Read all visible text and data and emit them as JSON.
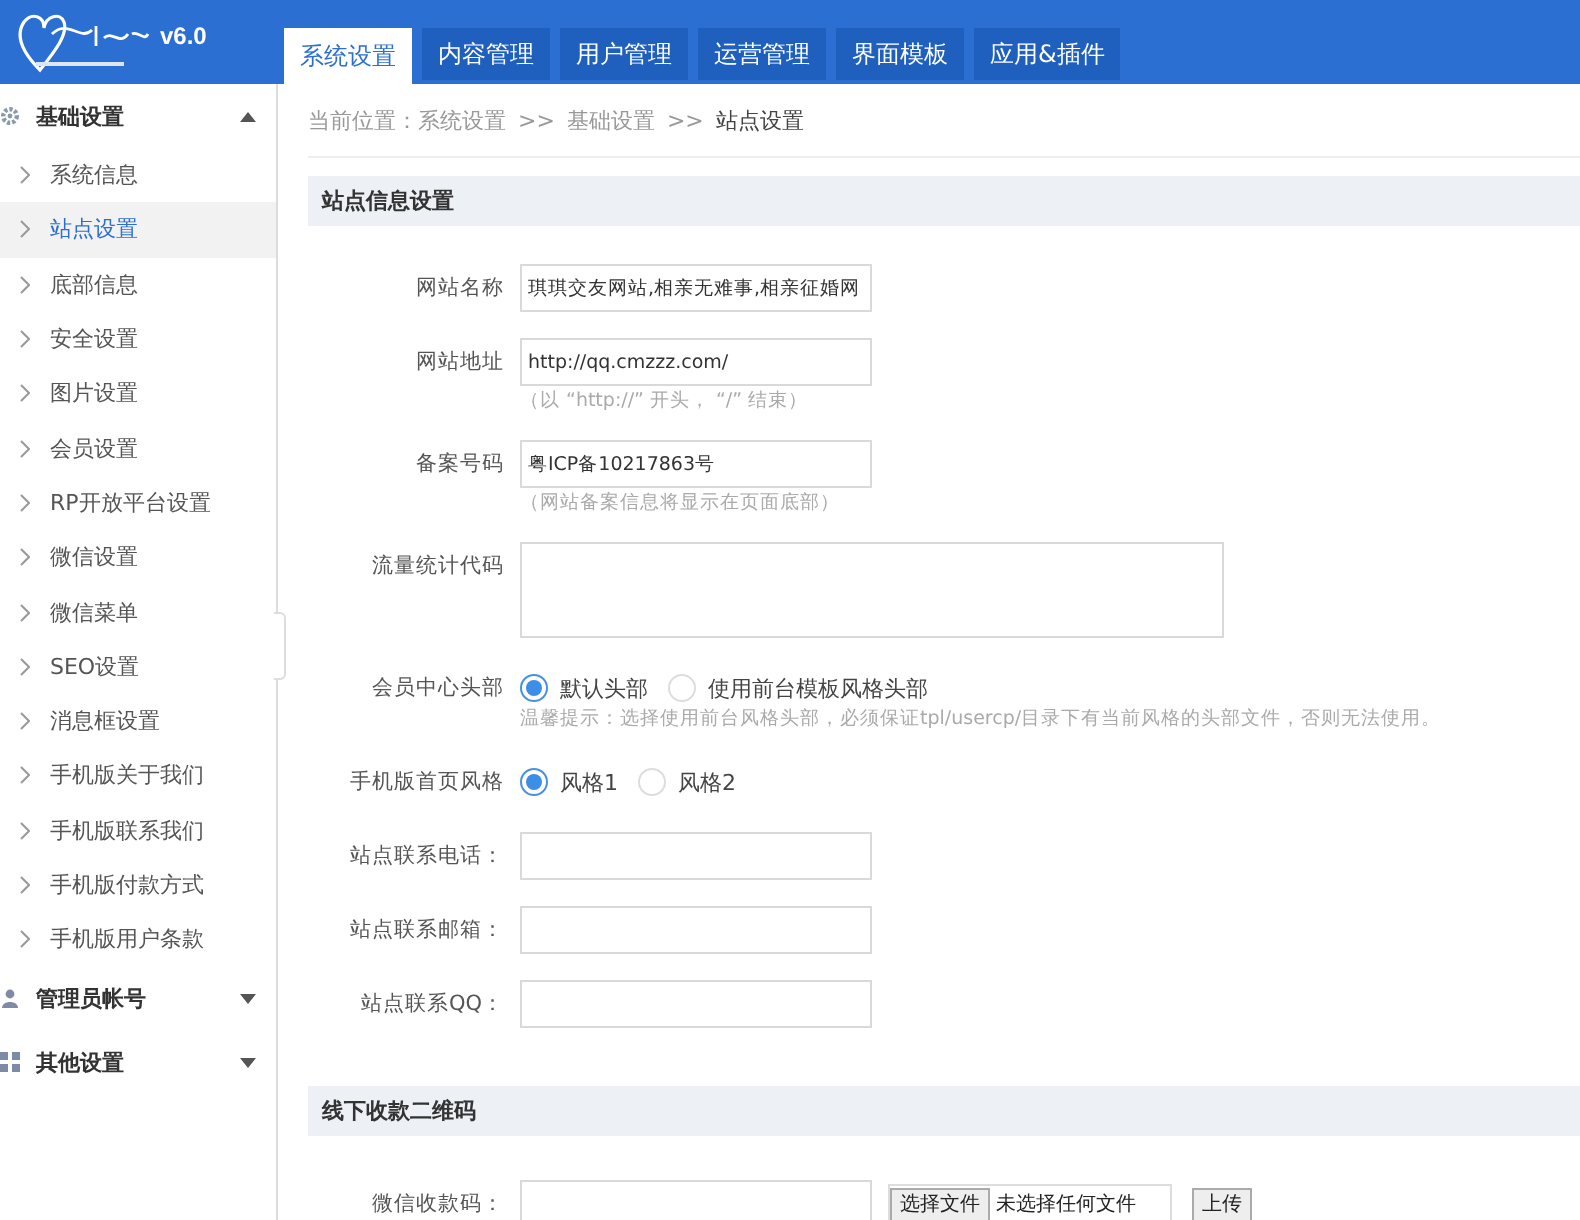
{
  "header": {
    "version": "v6.0",
    "tabs": [
      {
        "label": "系统设置",
        "selected": true
      },
      {
        "label": "内容管理",
        "selected": false
      },
      {
        "label": "用户管理",
        "selected": false
      },
      {
        "label": "运营管理",
        "selected": false
      },
      {
        "label": "界面模板",
        "selected": false
      },
      {
        "label": "应用&插件",
        "selected": false
      }
    ]
  },
  "sidebar": {
    "groups": [
      {
        "label": "基础设置",
        "expanded": true,
        "items": [
          {
            "label": "系统信息",
            "selected": false
          },
          {
            "label": "站点设置",
            "selected": true
          },
          {
            "label": "底部信息",
            "selected": false
          },
          {
            "label": "安全设置",
            "selected": false
          },
          {
            "label": "图片设置",
            "selected": false
          },
          {
            "label": "会员设置",
            "selected": false
          },
          {
            "label": "RP开放平台设置",
            "selected": false
          },
          {
            "label": "微信设置",
            "selected": false
          },
          {
            "label": "微信菜单",
            "selected": false
          },
          {
            "label": "SEO设置",
            "selected": false
          },
          {
            "label": "消息框设置",
            "selected": false
          },
          {
            "label": "手机版关于我们",
            "selected": false
          },
          {
            "label": "手机版联系我们",
            "selected": false
          },
          {
            "label": "手机版付款方式",
            "selected": false
          },
          {
            "label": "手机版用户条款",
            "selected": false
          }
        ]
      },
      {
        "label": "管理员帐号",
        "expanded": false
      },
      {
        "label": "其他设置",
        "expanded": false
      }
    ]
  },
  "breadcrumb": [
    {
      "text": "当前位置：系统设置",
      "current": false
    },
    {
      "text": ">>",
      "current": false
    },
    {
      "text": "基础设置",
      "current": false
    },
    {
      "text": ">>",
      "current": false
    },
    {
      "text": "站点设置",
      "current": true
    }
  ],
  "sections": [
    {
      "title": "站点信息设置",
      "fields": [
        {
          "kind": "text",
          "label": "网站名称",
          "value": "琪琪交友网站,相亲无难事,相亲征婚网"
        },
        {
          "kind": "text",
          "label": "网站地址",
          "value": "http://qq.cmzzz.com/",
          "hint": "（以 “http://” 开头， “/” 结束）"
        },
        {
          "kind": "text",
          "label": "备案号码",
          "value": "粤ICP备10217863号",
          "hint": "（网站备案信息将显示在页面底部）"
        },
        {
          "kind": "textarea",
          "label": "流量统计代码"
        },
        {
          "kind": "radio",
          "label": "会员中心头部",
          "options": [
            {
              "label": "默认头部",
              "selected": true
            },
            {
              "label": "使用前台模板风格头部",
              "selected": false
            }
          ],
          "hint": "温馨提示：选择使用前台风格头部，必须保证tpl/usercp/目录下有当前风格的头部文件，否则无法使用。"
        },
        {
          "kind": "radio",
          "label": "手机版首页风格",
          "options": [
            {
              "label": "风格1",
              "selected": true
            },
            {
              "label": "风格2",
              "selected": false
            }
          ]
        },
        {
          "kind": "text",
          "label": "站点联系电话："
        },
        {
          "kind": "text",
          "label": "站点联系邮箱："
        },
        {
          "kind": "text",
          "label": "站点联系QQ："
        }
      ]
    },
    {
      "title": "线下收款二维码",
      "fields": [
        {
          "kind": "file",
          "label": "微信收款码：",
          "choose": "选择文件",
          "status": "未选择任何文件",
          "upload": "上传"
        }
      ]
    }
  ]
}
